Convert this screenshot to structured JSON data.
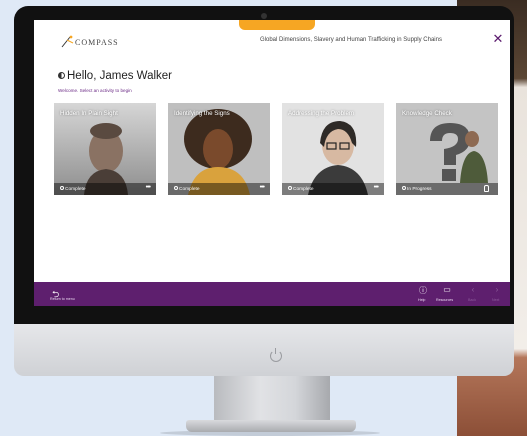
{
  "header": {
    "progress_label": "",
    "logo_text": "COMPASS",
    "course_title": "Global Dimensions, Slavery and Human Trafficking in Supply Chains",
    "close_glyph": "✕"
  },
  "main": {
    "greeting": "Hello, James Walker",
    "subtitle": "Welcome. Select an activity to begin",
    "cards": [
      {
        "title": "Hidden In Plain Sight",
        "status": "Complete",
        "action": "more",
        "accent": "#6c5a4e"
      },
      {
        "title": "Identifying the Signs",
        "status": "Complete",
        "action": "more",
        "accent": "#c98b3b"
      },
      {
        "title": "Addressing the Problem",
        "status": "Complete",
        "action": "more",
        "accent": "#6e6e6e"
      },
      {
        "title": "Knowledge Check",
        "status": "In Progress",
        "action": "lock",
        "accent": "#5a6b4a"
      }
    ]
  },
  "footer": {
    "back_label": "Return to menu",
    "help_label": "Help",
    "resources_label": "Resources",
    "prev_label": "Back",
    "next_label": "Next"
  },
  "colors": {
    "brand_purple": "#5e1f6e",
    "accent_orange": "#f6a623"
  }
}
